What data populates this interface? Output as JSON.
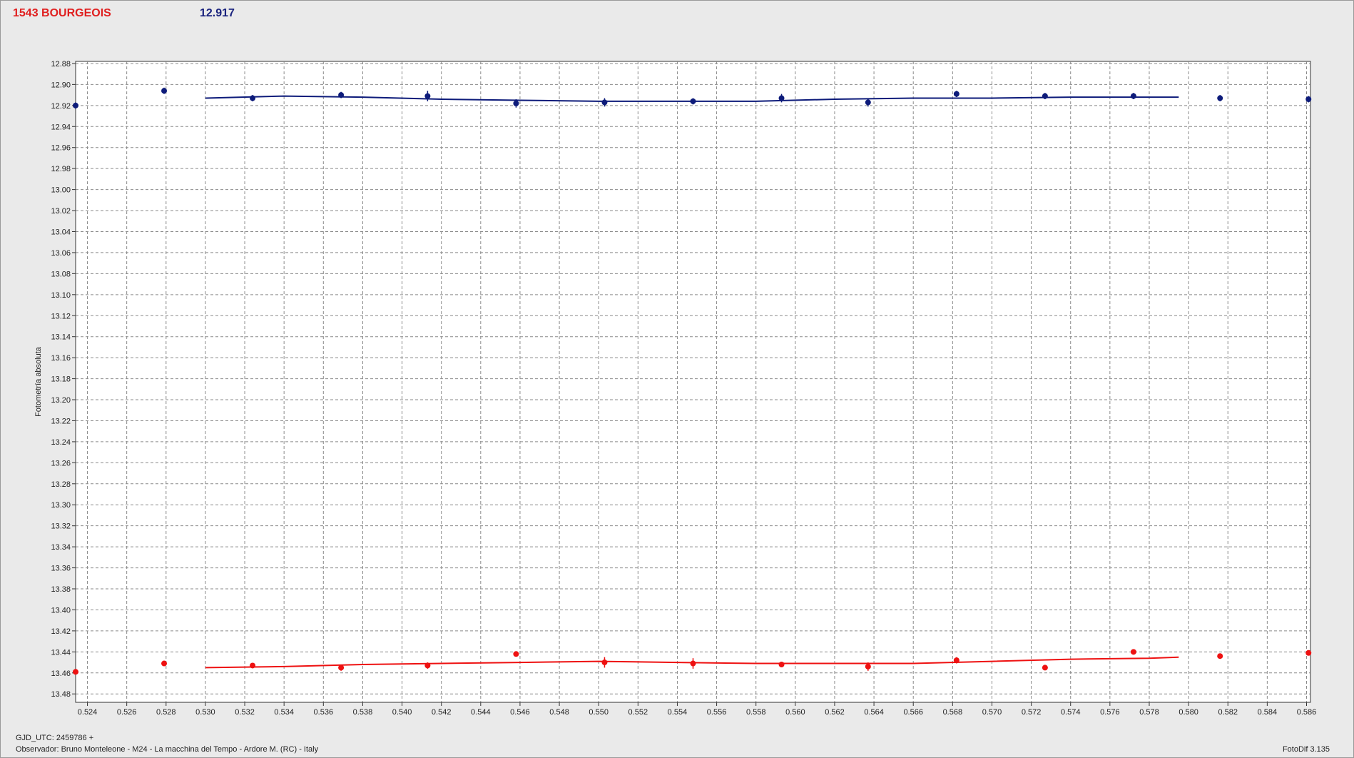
{
  "header": {
    "object_name": "1543 BOURGEOIS",
    "magnitude": "12.917"
  },
  "footer": {
    "gjd": "GJD_UTC: 2459786 +",
    "observer": "Observador: Bruno Monteleone - M24 - La macchina del Tempo - Ardore M. (RC) - Italy",
    "version": "FotoDif 3.135"
  },
  "colors": {
    "background": "#eaeaea",
    "plot_background": "#ffffff",
    "grid": "#8a8a8a",
    "series_blue": "#0d1b7a",
    "series_red": "#ee1111"
  },
  "chart_data": {
    "type": "scatter",
    "ylabel": "Fotometría absoluta",
    "xlabel": "",
    "xlim": [
      0.5234,
      0.5862
    ],
    "ylim": [
      12.878,
      13.488
    ],
    "y_inverted": true,
    "grid": true,
    "x_ticks": [
      0.524,
      0.526,
      0.528,
      0.53,
      0.532,
      0.534,
      0.536,
      0.538,
      0.54,
      0.542,
      0.544,
      0.546,
      0.548,
      0.55,
      0.552,
      0.554,
      0.556,
      0.558,
      0.56,
      0.562,
      0.564,
      0.566,
      0.568,
      0.57,
      0.572,
      0.574,
      0.576,
      0.578,
      0.58,
      0.582,
      0.584,
      0.586
    ],
    "y_ticks": [
      12.88,
      12.9,
      12.92,
      12.94,
      12.96,
      12.98,
      13.0,
      13.02,
      13.04,
      13.06,
      13.08,
      13.1,
      13.12,
      13.14,
      13.16,
      13.18,
      13.2,
      13.22,
      13.24,
      13.26,
      13.28,
      13.3,
      13.32,
      13.34,
      13.36,
      13.38,
      13.4,
      13.42,
      13.44,
      13.46,
      13.48
    ],
    "series": [
      {
        "color": "#0d1b7a",
        "points": [
          {
            "x": 0.5234,
            "y": 12.92,
            "err": 0.003
          },
          {
            "x": 0.5279,
            "y": 12.906,
            "err": 0.003
          },
          {
            "x": 0.5324,
            "y": 12.913,
            "err": 0.003
          },
          {
            "x": 0.5369,
            "y": 12.91,
            "err": 0.003
          },
          {
            "x": 0.5413,
            "y": 12.911,
            "err": 0.005
          },
          {
            "x": 0.5458,
            "y": 12.918,
            "err": 0.004
          },
          {
            "x": 0.5503,
            "y": 12.917,
            "err": 0.004
          },
          {
            "x": 0.5548,
            "y": 12.916,
            "err": 0.003
          },
          {
            "x": 0.5593,
            "y": 12.913,
            "err": 0.004
          },
          {
            "x": 0.5637,
            "y": 12.917,
            "err": 0.004
          },
          {
            "x": 0.5682,
            "y": 12.909,
            "err": 0.003
          },
          {
            "x": 0.5727,
            "y": 12.911,
            "err": 0.003
          },
          {
            "x": 0.5772,
            "y": 12.911,
            "err": 0.003
          },
          {
            "x": 0.5816,
            "y": 12.913,
            "err": 0.003
          },
          {
            "x": 0.5861,
            "y": 12.914,
            "err": 0.003
          }
        ],
        "fit": [
          {
            "x": 0.53,
            "y": 12.913
          },
          {
            "x": 0.534,
            "y": 12.911
          },
          {
            "x": 0.538,
            "y": 12.912
          },
          {
            "x": 0.542,
            "y": 12.914
          },
          {
            "x": 0.546,
            "y": 12.915
          },
          {
            "x": 0.55,
            "y": 12.916
          },
          {
            "x": 0.554,
            "y": 12.916
          },
          {
            "x": 0.558,
            "y": 12.916
          },
          {
            "x": 0.562,
            "y": 12.914
          },
          {
            "x": 0.566,
            "y": 12.913
          },
          {
            "x": 0.57,
            "y": 12.913
          },
          {
            "x": 0.574,
            "y": 12.912
          },
          {
            "x": 0.578,
            "y": 12.912
          },
          {
            "x": 0.5795,
            "y": 12.912
          }
        ]
      },
      {
        "color": "#ee1111",
        "points": [
          {
            "x": 0.5234,
            "y": 13.459,
            "err": 0.002
          },
          {
            "x": 0.5279,
            "y": 13.451,
            "err": 0.002
          },
          {
            "x": 0.5324,
            "y": 13.453,
            "err": 0.002
          },
          {
            "x": 0.5369,
            "y": 13.455,
            "err": 0.003
          },
          {
            "x": 0.5413,
            "y": 13.453,
            "err": 0.003
          },
          {
            "x": 0.5458,
            "y": 13.442,
            "err": 0.002
          },
          {
            "x": 0.5503,
            "y": 13.45,
            "err": 0.005
          },
          {
            "x": 0.5548,
            "y": 13.451,
            "err": 0.005
          },
          {
            "x": 0.5593,
            "y": 13.452,
            "err": 0.002
          },
          {
            "x": 0.5637,
            "y": 13.454,
            "err": 0.004
          },
          {
            "x": 0.5682,
            "y": 13.448,
            "err": 0.003
          },
          {
            "x": 0.5727,
            "y": 13.455,
            "err": 0.002
          },
          {
            "x": 0.5772,
            "y": 13.44,
            "err": 0.002
          },
          {
            "x": 0.5816,
            "y": 13.444,
            "err": 0.002
          },
          {
            "x": 0.5861,
            "y": 13.441,
            "err": 0.002
          }
        ],
        "fit": [
          {
            "x": 0.53,
            "y": 13.455
          },
          {
            "x": 0.534,
            "y": 13.454
          },
          {
            "x": 0.538,
            "y": 13.452
          },
          {
            "x": 0.542,
            "y": 13.451
          },
          {
            "x": 0.546,
            "y": 13.45
          },
          {
            "x": 0.55,
            "y": 13.449
          },
          {
            "x": 0.554,
            "y": 13.45
          },
          {
            "x": 0.558,
            "y": 13.451
          },
          {
            "x": 0.562,
            "y": 13.451
          },
          {
            "x": 0.566,
            "y": 13.451
          },
          {
            "x": 0.57,
            "y": 13.449
          },
          {
            "x": 0.574,
            "y": 13.447
          },
          {
            "x": 0.578,
            "y": 13.446
          },
          {
            "x": 0.5795,
            "y": 13.445
          }
        ]
      }
    ]
  }
}
